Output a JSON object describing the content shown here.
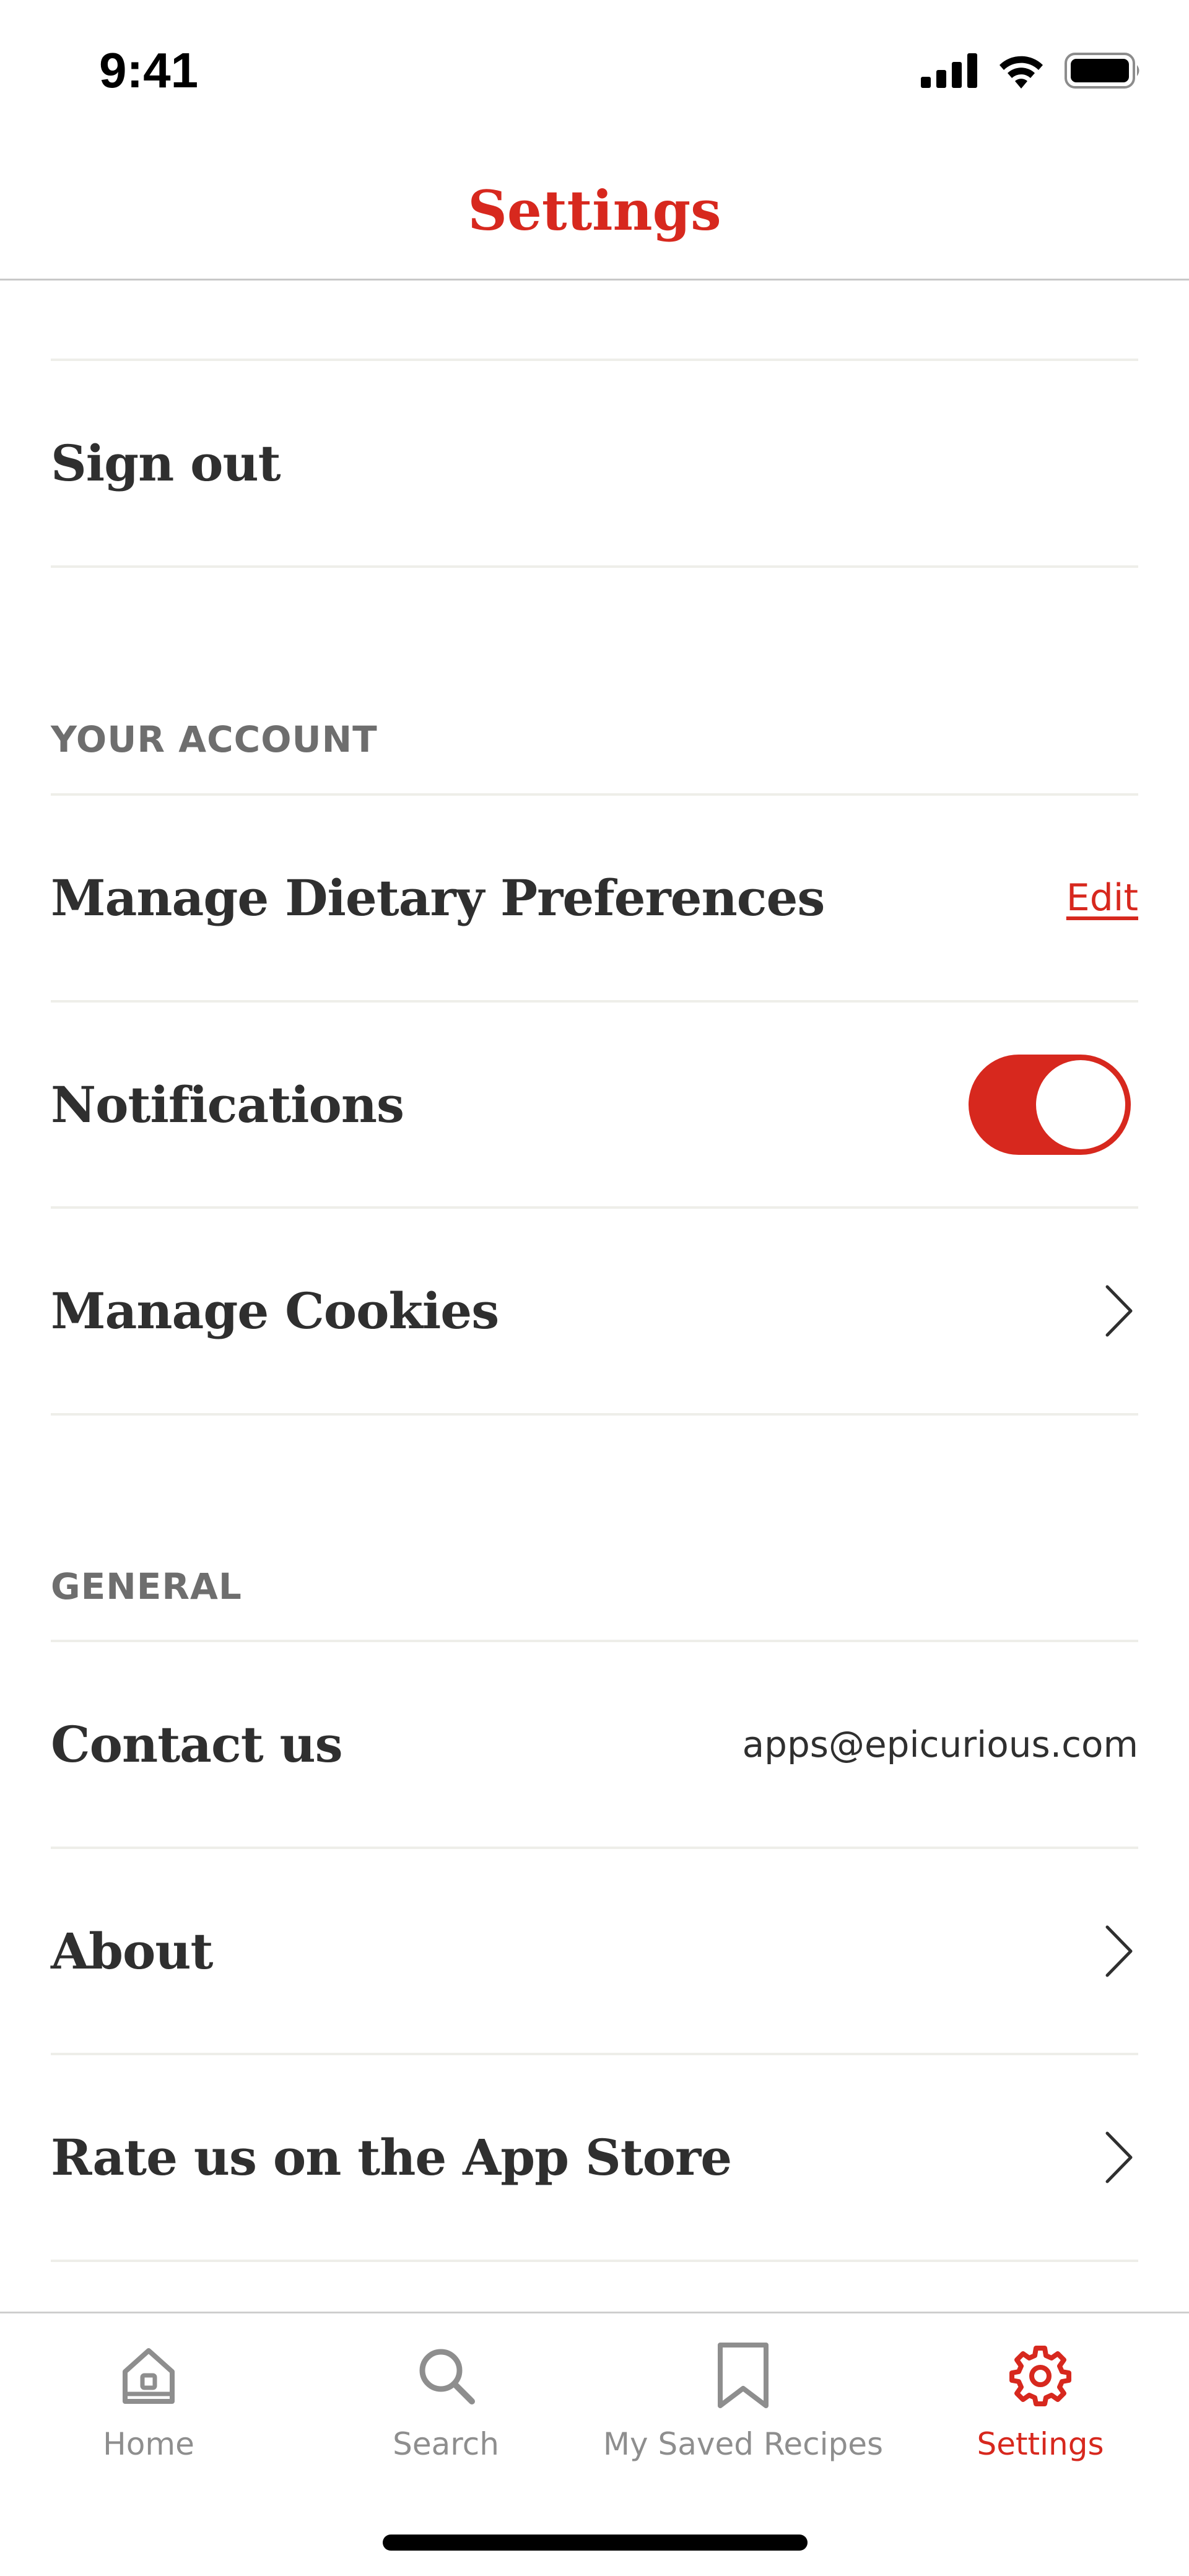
{
  "status_bar": {
    "time": "9:41"
  },
  "nav": {
    "title": "Settings"
  },
  "rows": {
    "sign_out": "Sign out",
    "manage_dietary": "Manage Dietary Preferences",
    "edit": "Edit",
    "notifications": "Notifications",
    "notifications_on": true,
    "manage_cookies": "Manage Cookies",
    "contact_us": "Contact us",
    "contact_email": "apps@epicurious.com",
    "about": "About",
    "rate": "Rate us on the App Store"
  },
  "sections": {
    "account": "YOUR ACCOUNT",
    "general": "GENERAL"
  },
  "tabs": [
    {
      "label": "Home",
      "icon": "home-icon",
      "active": false
    },
    {
      "label": "Search",
      "icon": "search-icon",
      "active": false
    },
    {
      "label": "My Saved Recipes",
      "icon": "bookmark-icon",
      "active": false
    },
    {
      "label": "Settings",
      "icon": "gear-icon",
      "active": true
    }
  ],
  "colors": {
    "accent": "#d7281e",
    "text": "#2f2f2f",
    "muted": "#8e8e8e",
    "divider": "#eeeee9"
  }
}
